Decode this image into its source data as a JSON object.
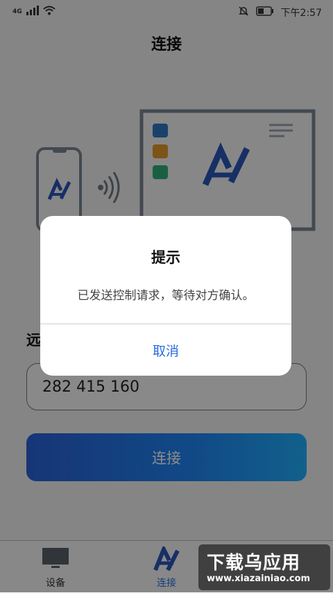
{
  "status_bar": {
    "network": "4G",
    "time": "下午2:57",
    "icons": [
      "signal-icon",
      "wifi-icon",
      "mute-bell-icon",
      "battery-icon"
    ]
  },
  "header": {
    "title": "连接"
  },
  "illustration": {
    "icons": [
      "phone-icon",
      "wireless-signal-icon",
      "monitor-icon",
      "app-logo-icon"
    ],
    "colors": [
      "#2f78c4",
      "#e49a2a",
      "#2fb07a",
      "#2a56b8"
    ]
  },
  "form": {
    "remote_label": "远",
    "device_code": "282 415 160",
    "connect_button": "连接"
  },
  "dialog": {
    "title": "提示",
    "message": "已发送控制请求，等待对方确认。",
    "cancel": "取消"
  },
  "bottom_nav": {
    "items": [
      {
        "label": "设备",
        "icon": "monitor-icon"
      },
      {
        "label": "连接",
        "icon": "app-logo-icon",
        "active": true
      }
    ]
  },
  "watermark": {
    "title": "下载乌应用",
    "url": "www.xiazainiao.com"
  }
}
